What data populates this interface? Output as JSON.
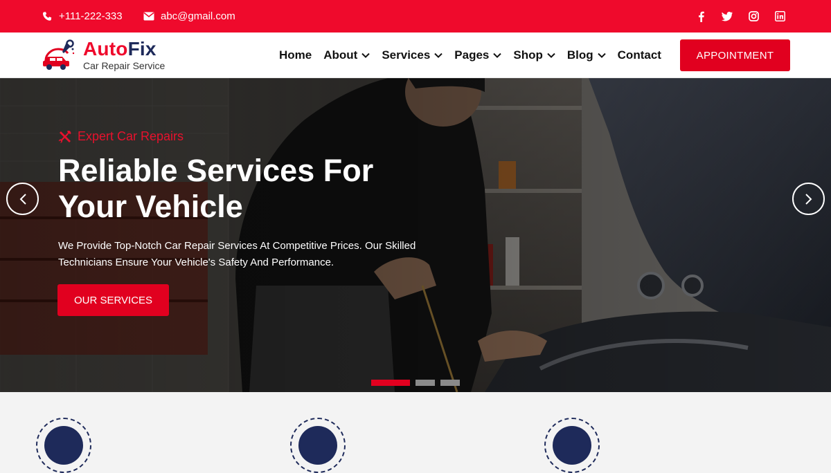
{
  "topbar": {
    "phone": "+111-222-333",
    "email": "abc@gmail.com",
    "socials": [
      "facebook-icon",
      "twitter-icon",
      "instagram-icon",
      "linkedin-icon"
    ]
  },
  "brand": {
    "name_part1": "Auto",
    "name_part2": "Fix",
    "tagline": "Car Repair Service",
    "accent": "#ef0a2c",
    "navy": "#1e2a5a"
  },
  "nav": {
    "items": [
      {
        "label": "Home",
        "dropdown": false
      },
      {
        "label": "About",
        "dropdown": true
      },
      {
        "label": "Services",
        "dropdown": true
      },
      {
        "label": "Pages",
        "dropdown": true
      },
      {
        "label": "Shop",
        "dropdown": true
      },
      {
        "label": "Blog",
        "dropdown": true
      },
      {
        "label": "Contact",
        "dropdown": false
      }
    ],
    "cta": "APPOINTMENT"
  },
  "hero": {
    "eyebrow": "Expert Car Repairs",
    "title_line1": "Reliable Services For",
    "title_line2": "Your Vehicle",
    "desc_line1": "We Provide Top-Notch Car Repair Services At Competitive Prices. Our Skilled",
    "desc_line2": "Technicians Ensure Your Vehicle's Safety And Performance.",
    "button": "OUR SERVICES",
    "slides_total": 3,
    "active_slide": 1
  }
}
